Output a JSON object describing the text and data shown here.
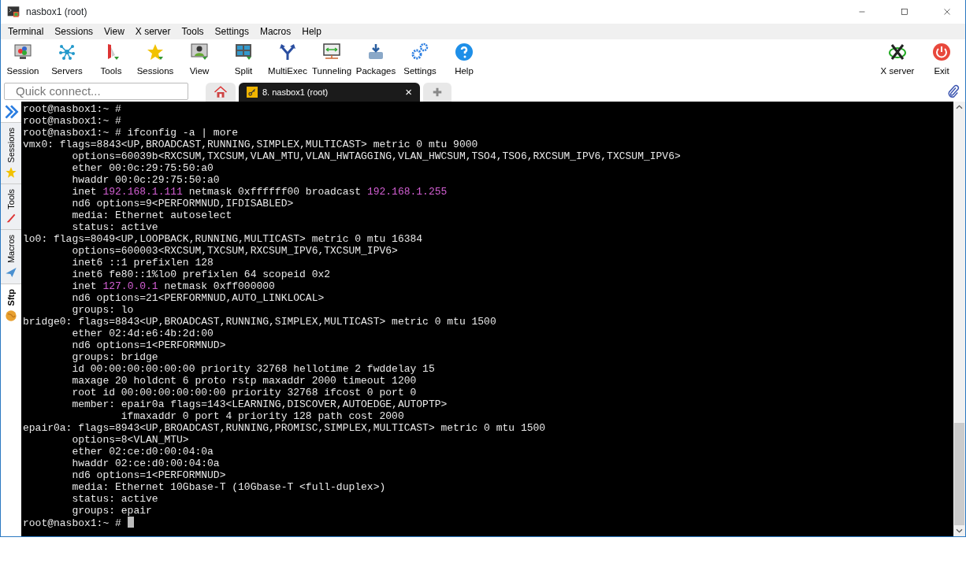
{
  "window": {
    "title": "nasbox1 (root)"
  },
  "menu": [
    "Terminal",
    "Sessions",
    "View",
    "X server",
    "Tools",
    "Settings",
    "Macros",
    "Help"
  ],
  "toolbar": {
    "left": [
      "Session",
      "Servers",
      "Tools",
      "Sessions",
      "View",
      "Split",
      "MultiExec",
      "Tunneling",
      "Packages",
      "Settings",
      "Help"
    ],
    "right": [
      "X server",
      "Exit"
    ]
  },
  "quick_connect": {
    "placeholder": "Quick connect..."
  },
  "tabs": [
    {
      "kind": "home",
      "selected": false
    },
    {
      "kind": "session",
      "label": "8. nasbox1 (root)",
      "selected": true,
      "close": "×"
    },
    {
      "kind": "new",
      "selected": false
    }
  ],
  "side_tabs": [
    {
      "label": "Sessions",
      "selected": false
    },
    {
      "label": "Tools",
      "selected": false
    },
    {
      "label": "Macros",
      "selected": false
    },
    {
      "label": "Sftp",
      "selected": true
    }
  ],
  "terminal": {
    "lines": [
      [
        {
          "text": "root@nasbox1:~ #"
        }
      ],
      [
        {
          "text": "root@nasbox1:~ #"
        }
      ],
      [
        {
          "text": "root@nasbox1:~ # ifconfig -a | more"
        }
      ],
      [
        {
          "text": "vmx0: flags=8843<UP,BROADCAST,RUNNING,SIMPLEX,MULTICAST> metric 0 mtu 9000"
        }
      ],
      [
        {
          "text": "        options=60039b<RXCSUM,TXCSUM,VLAN_MTU,VLAN_HWTAGGING,VLAN_HWCSUM,TSO4,TSO6,RXCSUM_IPV6,TXCSUM_IPV6>"
        }
      ],
      [
        {
          "text": "        ether 00:0c:29:75:50:a0"
        }
      ],
      [
        {
          "text": "        hwaddr 00:0c:29:75:50:a0"
        }
      ],
      [
        {
          "text": "        inet "
        },
        {
          "text": "192.168.1.111",
          "highlight": true
        },
        {
          "text": " netmask 0xffffff00 broadcast "
        },
        {
          "text": "192.168.1.255",
          "highlight": true
        }
      ],
      [
        {
          "text": "        nd6 options=9<PERFORMNUD,IFDISABLED>"
        }
      ],
      [
        {
          "text": "        media: Ethernet autoselect"
        }
      ],
      [
        {
          "text": "        status: active"
        }
      ],
      [
        {
          "text": "lo0: flags=8049<UP,LOOPBACK,RUNNING,MULTICAST> metric 0 mtu 16384"
        }
      ],
      [
        {
          "text": "        options=600003<RXCSUM,TXCSUM,RXCSUM_IPV6,TXCSUM_IPV6>"
        }
      ],
      [
        {
          "text": "        inet6 ::1 prefixlen 128"
        }
      ],
      [
        {
          "text": "        inet6 fe80::1%lo0 prefixlen 64 scopeid 0x2"
        }
      ],
      [
        {
          "text": "        inet "
        },
        {
          "text": "127.0.0.1",
          "highlight": true
        },
        {
          "text": " netmask 0xff000000"
        }
      ],
      [
        {
          "text": "        nd6 options=21<PERFORMNUD,AUTO_LINKLOCAL>"
        }
      ],
      [
        {
          "text": "        groups: lo"
        }
      ],
      [
        {
          "text": "bridge0: flags=8843<UP,BROADCAST,RUNNING,SIMPLEX,MULTICAST> metric 0 mtu 1500"
        }
      ],
      [
        {
          "text": "        ether 02:4d:e6:4b:2d:00"
        }
      ],
      [
        {
          "text": "        nd6 options=1<PERFORMNUD>"
        }
      ],
      [
        {
          "text": "        groups: bridge"
        }
      ],
      [
        {
          "text": "        id 00:00:00:00:00:00 priority 32768 hellotime 2 fwddelay 15"
        }
      ],
      [
        {
          "text": "        maxage 20 holdcnt 6 proto rstp maxaddr 2000 timeout 1200"
        }
      ],
      [
        {
          "text": "        root id 00:00:00:00:00:00 priority 32768 ifcost 0 port 0"
        }
      ],
      [
        {
          "text": "        member: epair0a flags=143<LEARNING,DISCOVER,AUTOEDGE,AUTOPTP>"
        }
      ],
      [
        {
          "text": "                ifmaxaddr 0 port 4 priority 128 path cost 2000"
        }
      ],
      [
        {
          "text": "epair0a: flags=8943<UP,BROADCAST,RUNNING,PROMISC,SIMPLEX,MULTICAST> metric 0 mtu 1500"
        }
      ],
      [
        {
          "text": "        options=8<VLAN_MTU>"
        }
      ],
      [
        {
          "text": "        ether 02:ce:d0:00:04:0a"
        }
      ],
      [
        {
          "text": "        hwaddr 02:ce:d0:00:04:0a"
        }
      ],
      [
        {
          "text": "        nd6 options=1<PERFORMNUD>"
        }
      ],
      [
        {
          "text": "        media: Ethernet 10Gbase-T (10Gbase-T <full-duplex>)"
        }
      ],
      [
        {
          "text": "        status: active"
        }
      ],
      [
        {
          "text": "        groups: epair"
        }
      ],
      [
        {
          "text": "root@nasbox1:~ # ",
          "cursor": true
        }
      ]
    ]
  }
}
